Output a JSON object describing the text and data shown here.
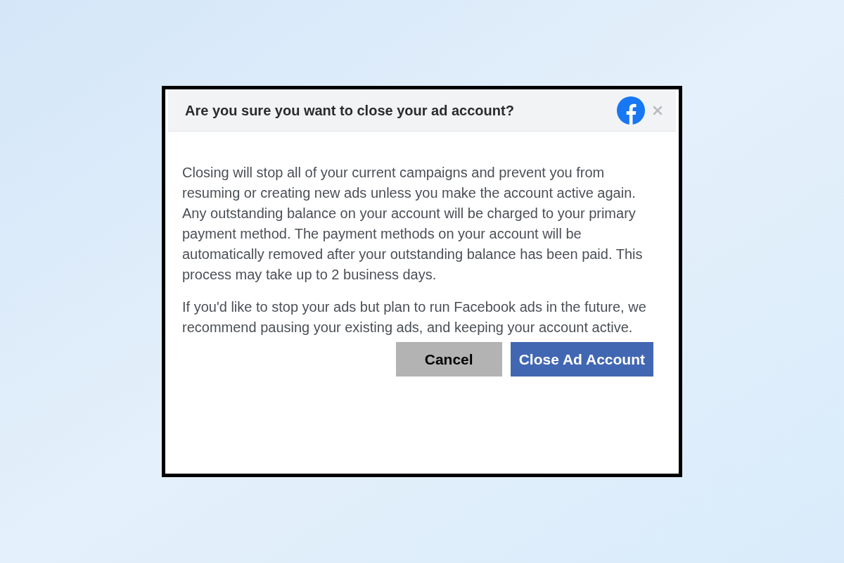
{
  "dialog": {
    "title": "Are you sure you want to close your ad account?",
    "paragraphs": [
      "Closing will stop all of your current campaigns and prevent you from resuming or creating new ads unless you make the account active again. Any outstanding balance on your account will be charged to your primary payment method. The payment methods on your account will be automatically removed after your outstanding balance has been paid. This process may take up to 2 business days.",
      "If you'd like to stop your ads but plan to run Facebook ads in the future, we recommend pausing your existing ads, and keeping your account active."
    ],
    "buttons": [
      {
        "label": "Cancel",
        "kind": "secondary"
      },
      {
        "label": "Close Ad Account",
        "kind": "primary"
      }
    ]
  }
}
